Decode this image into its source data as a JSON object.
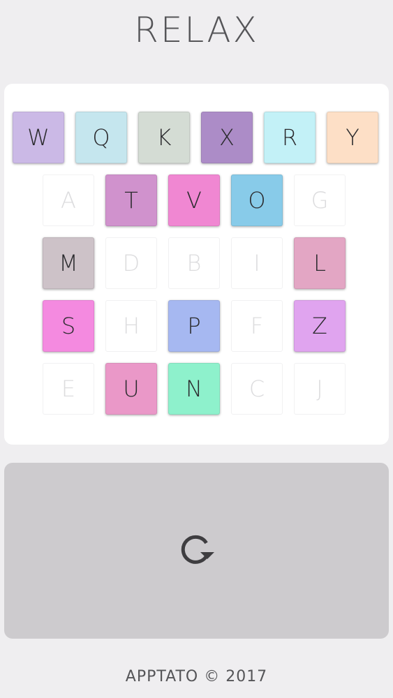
{
  "title": "RELAX",
  "footer": "APPTATO © 2017",
  "board": {
    "rows": [
      [
        {
          "letter": "W",
          "color": "#cbb9e6",
          "filled": true
        },
        {
          "letter": "Q",
          "color": "#c5e6ee",
          "filled": true
        },
        {
          "letter": "K",
          "color": "#d4dcd4",
          "filled": true
        },
        {
          "letter": "X",
          "color": "#ac8cc7",
          "filled": true
        },
        {
          "letter": "R",
          "color": "#c3f1f7",
          "filled": true
        },
        {
          "letter": "Y",
          "color": "#fddfc6",
          "filled": true
        }
      ],
      [
        {
          "letter": "A",
          "filled": false
        },
        {
          "letter": "T",
          "color": "#d092cd",
          "filled": true
        },
        {
          "letter": "V",
          "color": "#f087d2",
          "filled": true
        },
        {
          "letter": "O",
          "color": "#88cbe9",
          "filled": true
        },
        {
          "letter": "G",
          "filled": false
        }
      ],
      [
        {
          "letter": "M",
          "color": "#cdc2c8",
          "filled": true
        },
        {
          "letter": "D",
          "filled": false
        },
        {
          "letter": "B",
          "filled": false
        },
        {
          "letter": "I",
          "filled": false
        },
        {
          "letter": "L",
          "color": "#e3a6c4",
          "filled": true
        }
      ],
      [
        {
          "letter": "S",
          "color": "#f48ae0",
          "filled": true
        },
        {
          "letter": "H",
          "filled": false
        },
        {
          "letter": "P",
          "color": "#a6b8f1",
          "filled": true
        },
        {
          "letter": "F",
          "filled": false
        },
        {
          "letter": "Z",
          "color": "#e0a4ef",
          "filled": true
        }
      ],
      [
        {
          "letter": "E",
          "filled": false
        },
        {
          "letter": "U",
          "color": "#ea98c8",
          "filled": true
        },
        {
          "letter": "N",
          "color": "#8ef1cc",
          "filled": true
        },
        {
          "letter": "C",
          "filled": false
        },
        {
          "letter": "J",
          "filled": false
        }
      ]
    ]
  },
  "refresh_icon": "refresh-icon",
  "colors": {
    "background": "#efeef0",
    "board": "#ffffff",
    "panel": "#cdcbce",
    "text": "#555558",
    "icon": "#3e3d40"
  }
}
